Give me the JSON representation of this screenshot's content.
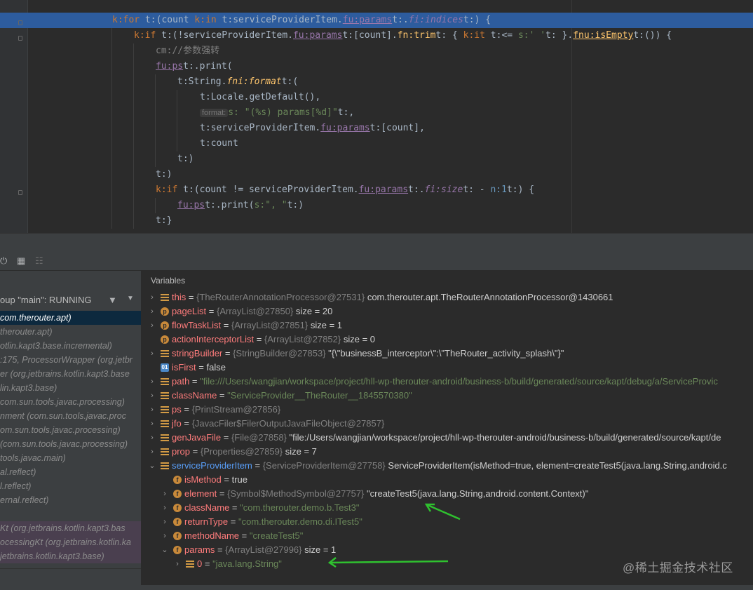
{
  "editor": {
    "lines": [
      [
        "k:for ",
        "t:(count ",
        "k:in ",
        "t:serviceProviderItem.",
        "fu:params",
        "t:.",
        "fi:indices",
        "t:) {"
      ],
      [
        "k:if ",
        "t:(!serviceProviderItem.",
        "fu:params",
        "t:[count].",
        "fn:trim",
        "t: { ",
        "k:it ",
        "t:<= ",
        "s:' '",
        "t: }.",
        "fnu:isEmpty",
        "t:()) {"
      ],
      [
        "cm://参数强转"
      ],
      [
        "fu:ps",
        "t:.print("
      ],
      [
        "t:String.",
        "fni:format",
        "t:("
      ],
      [
        "t:Locale.getDefault(),"
      ],
      [
        "h:format:",
        "s: \"(%s) params[%d]\"",
        "t:,"
      ],
      [
        "t:serviceProviderItem.",
        "fu:params",
        "t:[count],"
      ],
      [
        "t:count"
      ],
      [
        "t:)"
      ],
      [
        "t:)"
      ],
      [
        "k:if ",
        "t:(count != serviceProviderItem.",
        "fu:params",
        "t:.",
        "fi:size",
        "t: - ",
        "n:1",
        "t:) {"
      ],
      [
        "fu:ps",
        "t:.print(",
        "s:\", \"",
        "t:)"
      ],
      [
        "t:}"
      ]
    ]
  },
  "frames": {
    "thread_label": "oup \"main\": RUNNING",
    "items": [
      {
        "text": "com.therouter.apt)",
        "pk": ""
      },
      {
        "text": "therouter.apt)",
        "pk": ""
      },
      {
        "text": "otlin.kapt3.base.incremental)",
        "pk": ""
      },
      {
        "text": ":175, ProcessorWrapper (org.jetbr",
        "pk": ""
      },
      {
        "text": "er (org.jetbrains.kotlin.kapt3.base",
        "pk": ""
      },
      {
        "text": "lin.kapt3.base)",
        "pk": ""
      },
      {
        "text": "com.sun.tools.javac.processing)",
        "pk": ""
      },
      {
        "text": "nment (com.sun.tools.javac.proc",
        "pk": ""
      },
      {
        "text": "om.sun.tools.javac.processing)",
        "pk": ""
      },
      {
        "text": "(com.sun.tools.javac.processing)",
        "pk": ""
      },
      {
        "text": "tools.javac.main)",
        "pk": ""
      },
      {
        "text": "al.reflect)",
        "pk": ""
      },
      {
        "text": "l.reflect)",
        "pk": ""
      },
      {
        "text": "ernal.reflect)",
        "pk": ""
      },
      {
        "text": "",
        "pk": ""
      },
      {
        "text": "Kt (org.jetbrains.kotlin.kapt3.bas",
        "pk": ""
      },
      {
        "text": "ocessingKt (org.jetbrains.kotlin.ka",
        "pk": ""
      },
      {
        "text": "jetbrains.kotlin.kapt3.base)",
        "pk": ""
      }
    ]
  },
  "variables": {
    "title": "Variables",
    "rows": [
      {
        "arrow": "›",
        "icon": "list",
        "name": "this",
        "eq": " = ",
        "type": "{TheRouterAnnotationProcessor@27531}",
        "val": " com.therouter.apt.TheRouterAnnotationProcessor@1430661",
        "str": ""
      },
      {
        "arrow": "›",
        "icon": "p",
        "name": "pageList",
        "eq": " = ",
        "type": "{ArrayList@27850}",
        "val": "  size = 20",
        "str": ""
      },
      {
        "arrow": "›",
        "icon": "p",
        "name": "flowTaskList",
        "eq": " = ",
        "type": "{ArrayList@27851}",
        "val": "  size = 1",
        "str": ""
      },
      {
        "arrow": "",
        "icon": "p",
        "name": "actionInterceptorList",
        "eq": " = ",
        "type": "{ArrayList@27852}",
        "val": "  size = 0",
        "str": ""
      },
      {
        "arrow": "›",
        "icon": "list",
        "name": "stringBuilder",
        "eq": " = ",
        "type": "{StringBuilder@27853}",
        "val": " \"{\\\"businessB_interceptor\\\":\\\"TheRouter_activity_splash\\\"}\"",
        "str": ""
      },
      {
        "arrow": "",
        "icon": "bool",
        "name": "isFirst",
        "eq": " = ",
        "type": "",
        "val": "false",
        "str": ""
      },
      {
        "arrow": "›",
        "icon": "list",
        "name": "path",
        "eq": " = ",
        "type": "",
        "val": "",
        "str": "\"file:///Users/wangjian/workspace/project/hll-wp-therouter-android/business-b/build/generated/source/kapt/debug/a/ServiceProvic"
      },
      {
        "arrow": "›",
        "icon": "list",
        "name": "className",
        "eq": " = ",
        "type": "",
        "val": "",
        "str": "\"ServiceProvider__TheRouter__1845570380\""
      },
      {
        "arrow": "›",
        "icon": "list",
        "name": "ps",
        "eq": " = ",
        "type": "{PrintStream@27856}",
        "val": "",
        "str": ""
      },
      {
        "arrow": "›",
        "icon": "list",
        "name": "jfo",
        "eq": " = ",
        "type": "{JavacFiler$FilerOutputJavaFileObject@27857}",
        "val": "",
        "str": ""
      },
      {
        "arrow": "›",
        "icon": "list",
        "name": "genJavaFile",
        "eq": " = ",
        "type": "{File@27858}",
        "val": " \"file:/Users/wangjian/workspace/project/hll-wp-therouter-android/business-b/build/generated/source/kapt/de",
        "str": ""
      },
      {
        "arrow": "›",
        "icon": "list",
        "name": "prop",
        "eq": " = ",
        "type": "{Properties@27859}",
        "val": "  size = 7",
        "str": ""
      },
      {
        "arrow": "⌄",
        "icon": "list",
        "name": "serviceProviderItem",
        "eq": " = ",
        "type": "{ServiceProviderItem@27758}",
        "val": " ServiceProviderItem(isMethod=true, element=createTest5(java.lang.String,android.c",
        "str": "",
        "blue": true
      },
      {
        "arrow": "",
        "icon": "f",
        "name": "isMethod",
        "eq": " = ",
        "type": "",
        "val": "true",
        "str": "",
        "indent": 1
      },
      {
        "arrow": "›",
        "icon": "f",
        "name": "element",
        "eq": " = ",
        "type": "{Symbol$MethodSymbol@27757}",
        "val": " \"createTest5(java.lang.String,android.content.Context)\"",
        "str": "",
        "indent": 1
      },
      {
        "arrow": "›",
        "icon": "f",
        "name": "className",
        "eq": " = ",
        "type": "",
        "val": "",
        "str": "\"com.therouter.demo.b.Test3\"",
        "indent": 1
      },
      {
        "arrow": "›",
        "icon": "f",
        "name": "returnType",
        "eq": " = ",
        "type": "",
        "val": "",
        "str": "\"com.therouter.demo.di.ITest5\"",
        "indent": 1
      },
      {
        "arrow": "›",
        "icon": "f",
        "name": "methodName",
        "eq": " = ",
        "type": "",
        "val": "",
        "str": "\"createTest5\"",
        "indent": 1
      },
      {
        "arrow": "⌄",
        "icon": "f",
        "name": "params",
        "eq": " = ",
        "type": "{ArrayList@27996}",
        "val": "  size = 1",
        "str": "",
        "indent": 1
      },
      {
        "arrow": "›",
        "icon": "list",
        "name": "0",
        "eq": " = ",
        "type": "",
        "val": "",
        "str": "\"java.lang.String\"",
        "indent": 2
      }
    ]
  },
  "watermark": "@稀土掘金技术社区",
  "colors": {
    "accent": "#2d5c9e",
    "annotation": "#2fc12f",
    "breakpoint": "#c75450"
  }
}
